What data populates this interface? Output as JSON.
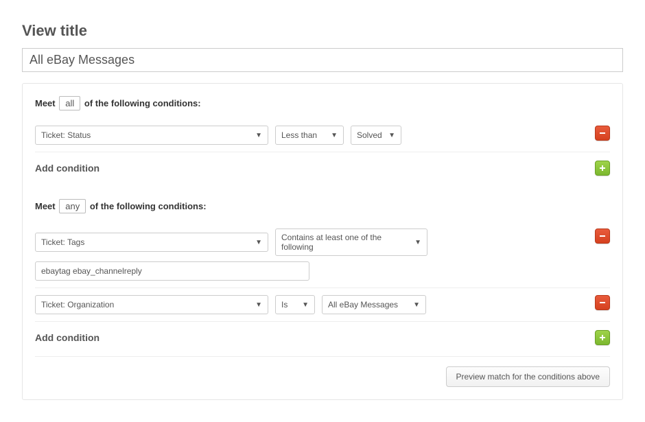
{
  "title_label": "View title",
  "title_value": "All eBay Messages",
  "all_block": {
    "prefix": "Meet",
    "chip": "all",
    "suffix": "of the following conditions:",
    "conditions": [
      {
        "field": "Ticket: Status",
        "operator": "Less than",
        "value": "Solved"
      }
    ],
    "add_label": "Add condition"
  },
  "any_block": {
    "prefix": "Meet",
    "chip": "any",
    "suffix": "of the following conditions:",
    "conditions": [
      {
        "field": "Ticket: Tags",
        "operator": "Contains at least one of the following",
        "tags_input": "ebaytag ebay_channelreply"
      },
      {
        "field": "Ticket: Organization",
        "operator": "Is",
        "value": "All eBay Messages"
      }
    ],
    "add_label": "Add condition"
  },
  "preview_label": "Preview match for the conditions above"
}
